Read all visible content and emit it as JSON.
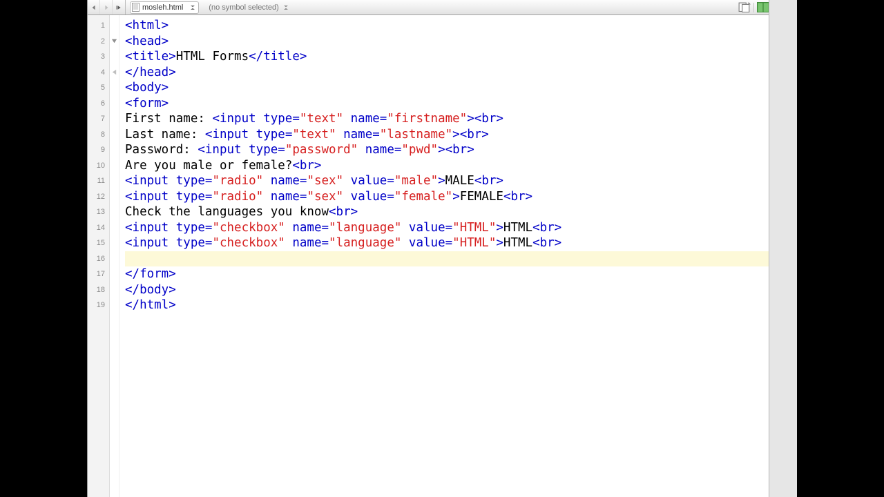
{
  "toolbar": {
    "filename": "mosleh.html",
    "symbol_selector": "(no symbol selected)"
  },
  "gutter": {
    "line_count": 19,
    "highlighted_line": 16
  },
  "code_lines": [
    [
      {
        "c": "tag",
        "t": "<html>"
      }
    ],
    [
      {
        "c": "tag",
        "t": "<head>"
      }
    ],
    [
      {
        "c": "tag",
        "t": "<title>"
      },
      {
        "c": "plain",
        "t": "HTML Forms"
      },
      {
        "c": "tag",
        "t": "</title>"
      }
    ],
    [
      {
        "c": "tag",
        "t": "</head>"
      }
    ],
    [
      {
        "c": "tag",
        "t": "<body>"
      }
    ],
    [
      {
        "c": "tag",
        "t": "<form>"
      }
    ],
    [
      {
        "c": "plain",
        "t": "First name: "
      },
      {
        "c": "tag",
        "t": "<input "
      },
      {
        "c": "attr",
        "t": "type="
      },
      {
        "c": "str",
        "t": "\"text\""
      },
      {
        "c": "attr",
        "t": " name="
      },
      {
        "c": "str",
        "t": "\"firstname\""
      },
      {
        "c": "tag",
        "t": "><br>"
      }
    ],
    [
      {
        "c": "plain",
        "t": "Last name: "
      },
      {
        "c": "tag",
        "t": "<input "
      },
      {
        "c": "attr",
        "t": "type="
      },
      {
        "c": "str",
        "t": "\"text\""
      },
      {
        "c": "attr",
        "t": " name="
      },
      {
        "c": "str",
        "t": "\"lastname\""
      },
      {
        "c": "tag",
        "t": "><br>"
      }
    ],
    [
      {
        "c": "plain",
        "t": "Password: "
      },
      {
        "c": "tag",
        "t": "<input "
      },
      {
        "c": "attr",
        "t": "type="
      },
      {
        "c": "str",
        "t": "\"password\""
      },
      {
        "c": "attr",
        "t": " name="
      },
      {
        "c": "str",
        "t": "\"pwd\""
      },
      {
        "c": "tag",
        "t": "><br>"
      }
    ],
    [
      {
        "c": "plain",
        "t": "Are you male or female?"
      },
      {
        "c": "tag",
        "t": "<br>"
      }
    ],
    [
      {
        "c": "tag",
        "t": "<input "
      },
      {
        "c": "attr",
        "t": "type="
      },
      {
        "c": "str",
        "t": "\"radio\""
      },
      {
        "c": "attr",
        "t": " name="
      },
      {
        "c": "str",
        "t": "\"sex\""
      },
      {
        "c": "attr",
        "t": " value="
      },
      {
        "c": "str",
        "t": "\"male\""
      },
      {
        "c": "tag",
        "t": ">"
      },
      {
        "c": "plain",
        "t": "MALE"
      },
      {
        "c": "tag",
        "t": "<br>"
      }
    ],
    [
      {
        "c": "tag",
        "t": "<input "
      },
      {
        "c": "attr",
        "t": "type="
      },
      {
        "c": "str",
        "t": "\"radio\""
      },
      {
        "c": "attr",
        "t": " name="
      },
      {
        "c": "str",
        "t": "\"sex\""
      },
      {
        "c": "attr",
        "t": " value="
      },
      {
        "c": "str",
        "t": "\"female\""
      },
      {
        "c": "tag",
        "t": ">"
      },
      {
        "c": "plain",
        "t": "FEMALE"
      },
      {
        "c": "tag",
        "t": "<br>"
      }
    ],
    [
      {
        "c": "plain",
        "t": "Check the languages you know"
      },
      {
        "c": "tag",
        "t": "<br>"
      }
    ],
    [
      {
        "c": "tag",
        "t": "<input "
      },
      {
        "c": "attr",
        "t": "type="
      },
      {
        "c": "str",
        "t": "\"checkbox\""
      },
      {
        "c": "attr",
        "t": " name="
      },
      {
        "c": "str",
        "t": "\"language\""
      },
      {
        "c": "attr",
        "t": " value="
      },
      {
        "c": "str",
        "t": "\"HTML\""
      },
      {
        "c": "tag",
        "t": ">"
      },
      {
        "c": "plain",
        "t": "HTML"
      },
      {
        "c": "tag",
        "t": "<br>"
      }
    ],
    [
      {
        "c": "tag",
        "t": "<input "
      },
      {
        "c": "attr",
        "t": "type="
      },
      {
        "c": "str",
        "t": "\"checkbox\""
      },
      {
        "c": "attr",
        "t": " name="
      },
      {
        "c": "str",
        "t": "\"language\""
      },
      {
        "c": "attr",
        "t": " value="
      },
      {
        "c": "str",
        "t": "\"HTML\""
      },
      {
        "c": "tag",
        "t": ">"
      },
      {
        "c": "plain",
        "t": "HTML"
      },
      {
        "c": "tag",
        "t": "<br>"
      }
    ],
    [],
    [
      {
        "c": "tag",
        "t": "</form>"
      }
    ],
    [
      {
        "c": "tag",
        "t": "</body>"
      }
    ],
    [
      {
        "c": "tag",
        "t": "</html>"
      }
    ]
  ]
}
